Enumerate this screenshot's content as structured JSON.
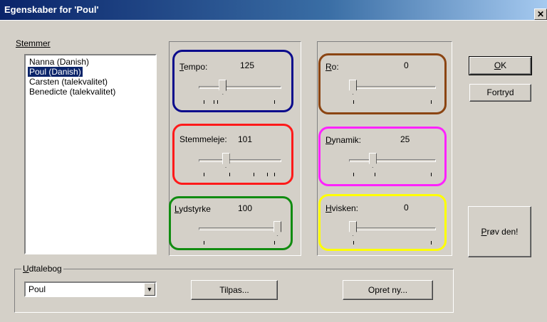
{
  "window": {
    "title": "Egenskaber for 'Poul'",
    "close_glyph": "✕"
  },
  "voices": {
    "label": "Stemmer",
    "items": [
      "Nanna (Danish)",
      "Poul (Danish)",
      "Carsten (talekvalitet)",
      "Benedicte (talekvalitet)"
    ],
    "selected_index": 1
  },
  "sliders": {
    "tempo": {
      "label": "Tempo:",
      "value": "125",
      "level": 0.27,
      "ring_color": "#0c0c8c"
    },
    "stemmeleje": {
      "label": "Stemmeleje:",
      "value": "101",
      "level": 0.31,
      "ring_color": "#ff1a1a"
    },
    "lydstyrke": {
      "label": "Lydstyrke",
      "value": "100",
      "level": 1.0,
      "ring_color": "#118c11"
    },
    "ro": {
      "label": "Ro:",
      "value": "0",
      "level": 0.0,
      "ring_color": "#8b4513"
    },
    "dynamik": {
      "label": "Dynamik:",
      "value": "25",
      "level": 0.25,
      "ring_color": "#ff22ff"
    },
    "hvisken": {
      "label": "Hvisken:",
      "value": "0",
      "level": 0.0,
      "ring_color": "#ffff00"
    }
  },
  "buttons": {
    "ok": "OK",
    "cancel": "Fortryd",
    "try": "Prøv den!",
    "customize": "Tilpas...",
    "create_new": "Opret ny..."
  },
  "dictionary": {
    "label": "Udtalebog",
    "selected": "Poul",
    "arrow_glyph": "▼"
  }
}
